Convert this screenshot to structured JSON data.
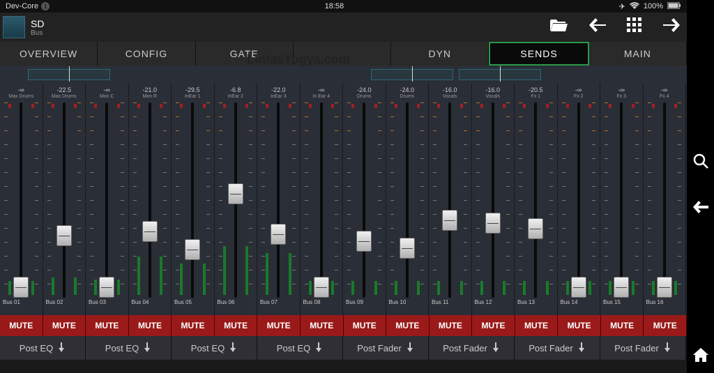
{
  "status": {
    "left": "Dev-Core",
    "badge": "1",
    "time": "18:58",
    "battery": "100%"
  },
  "title": {
    "main": "SD",
    "sub": "Bus"
  },
  "tabs": [
    {
      "label": "OVERVIEW",
      "active": false
    },
    {
      "label": "CONFIG",
      "active": false
    },
    {
      "label": "GATE",
      "active": false
    },
    {
      "label": "",
      "active": false
    },
    {
      "label": "DYN",
      "active": false
    },
    {
      "label": "SENDS",
      "active": true
    },
    {
      "label": "MAIN",
      "active": false
    }
  ],
  "watermark": "LintasYogya.com",
  "channels": [
    {
      "db": "-∞",
      "name": "Max Drums",
      "bus": "Bus 01",
      "fader": 250,
      "meter": 20
    },
    {
      "db": "-22.5",
      "name": "Max Drums",
      "bus": "Bus 02",
      "fader": 176,
      "meter": 25
    },
    {
      "db": "-∞",
      "name": "Mon C",
      "bus": "Bus 03",
      "fader": 250,
      "meter": 22
    },
    {
      "db": "-21.0",
      "name": "Mon R",
      "bus": "Bus 04",
      "fader": 170,
      "meter": 55
    },
    {
      "db": "-29.5",
      "name": "InEar 1",
      "bus": "Bus 05",
      "fader": 196,
      "meter": 45
    },
    {
      "db": "-6.8",
      "name": "InEar 2",
      "bus": "Bus 06",
      "fader": 116,
      "meter": 70
    },
    {
      "db": "-22.0",
      "name": "InEar 3",
      "bus": "Bus 07",
      "fader": 174,
      "meter": 60
    },
    {
      "db": "-∞",
      "name": "In Ear 4",
      "bus": "Bus 08",
      "fader": 250,
      "meter": 20
    },
    {
      "db": "-24.0",
      "name": "Drums",
      "bus": "Bus 09",
      "fader": 184,
      "meter": 20
    },
    {
      "db": "-24.0",
      "name": "Drums",
      "bus": "Bus 10",
      "fader": 194,
      "meter": 20
    },
    {
      "db": "-16.0",
      "name": "Vocals",
      "bus": "Bus 11",
      "fader": 154,
      "meter": 20
    },
    {
      "db": "-16.0",
      "name": "Vocals",
      "bus": "Bus 12",
      "fader": 158,
      "meter": 20
    },
    {
      "db": "-20.5",
      "name": "Fx 1",
      "bus": "Bus 13",
      "fader": 166,
      "meter": 20
    },
    {
      "db": "-∞",
      "name": "Fx 2",
      "bus": "Bus 14",
      "fader": 250,
      "meter": 20
    },
    {
      "db": "-∞",
      "name": "Fx 3",
      "bus": "Bus 15",
      "fader": 250,
      "meter": 20
    },
    {
      "db": "-∞",
      "name": "Fx 4",
      "bus": "Bus 16",
      "fader": 250,
      "meter": 20
    }
  ],
  "mute_label": "MUTE",
  "post_groups": [
    "Post EQ",
    "Post EQ",
    "Post EQ",
    "Post EQ",
    "Post Fader",
    "Post Fader",
    "Post Fader",
    "Post Fader"
  ]
}
